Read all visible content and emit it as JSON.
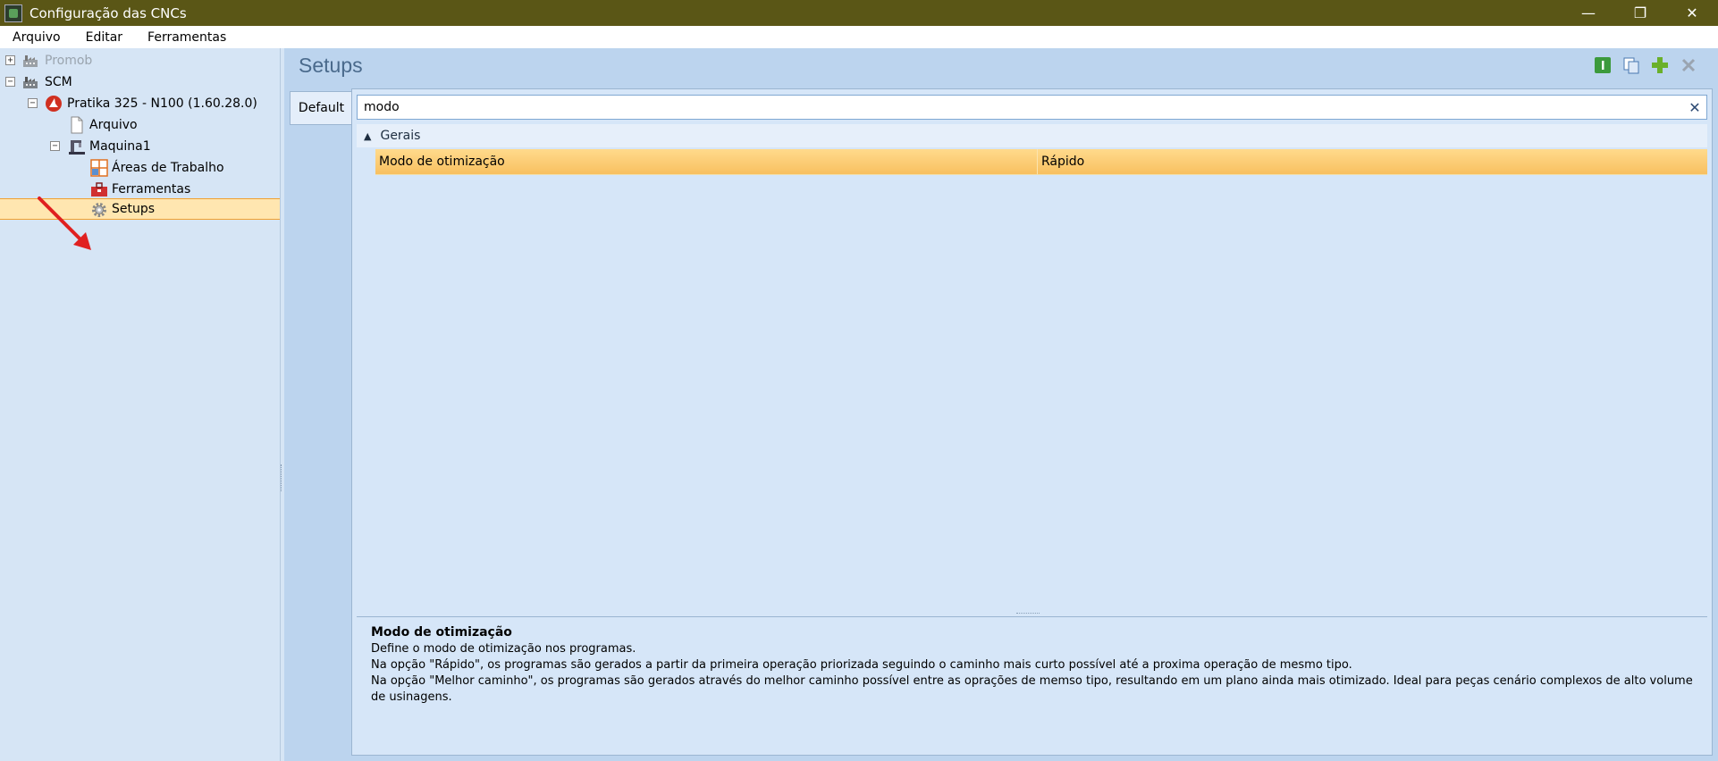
{
  "window": {
    "title": "Configuração das CNCs"
  },
  "window_controls": {
    "minimize": "—",
    "restore": "❐",
    "close": "✕"
  },
  "menu": [
    "Arquivo",
    "Editar",
    "Ferramentas"
  ],
  "tree": {
    "items": [
      {
        "label": "Promob",
        "expander": "+"
      },
      {
        "label": "SCM",
        "expander": "−"
      },
      {
        "label": "Pratika 325 - N100 (1.60.28.0)",
        "expander": "−"
      },
      {
        "label": "Arquivo"
      },
      {
        "label": "Maquina1",
        "expander": "−"
      },
      {
        "label": "Áreas de Trabalho"
      },
      {
        "label": "Ferramentas"
      },
      {
        "label": "Setups"
      }
    ]
  },
  "content": {
    "title": "Setups",
    "tab": "Default",
    "search": {
      "value": "modo",
      "clear": "✕"
    },
    "group": "Gerais",
    "property": {
      "name": "Modo de otimização",
      "value": "Rápido"
    },
    "description": {
      "title": "Modo de otimização",
      "lines": [
        "Define o modo de otimização nos programas.",
        "Na opção \"Rápido\", os programas são gerados a partir da primeira operação priorizada seguindo o caminho mais curto possível até a proxima operação de mesmo tipo.",
        "Na opção \"Melhor caminho\", os programas são gerados através do melhor caminho possível entre as oprações de memso tipo, resultando em um plano ainda mais otimizado. Ideal para peças cenário complexos de alto volume de usinagens."
      ]
    }
  },
  "colors": {
    "titlebar": "#5a5616",
    "selection": "#ffda8c",
    "panel": "#d6e6f8",
    "accent_red": "#e02020"
  }
}
